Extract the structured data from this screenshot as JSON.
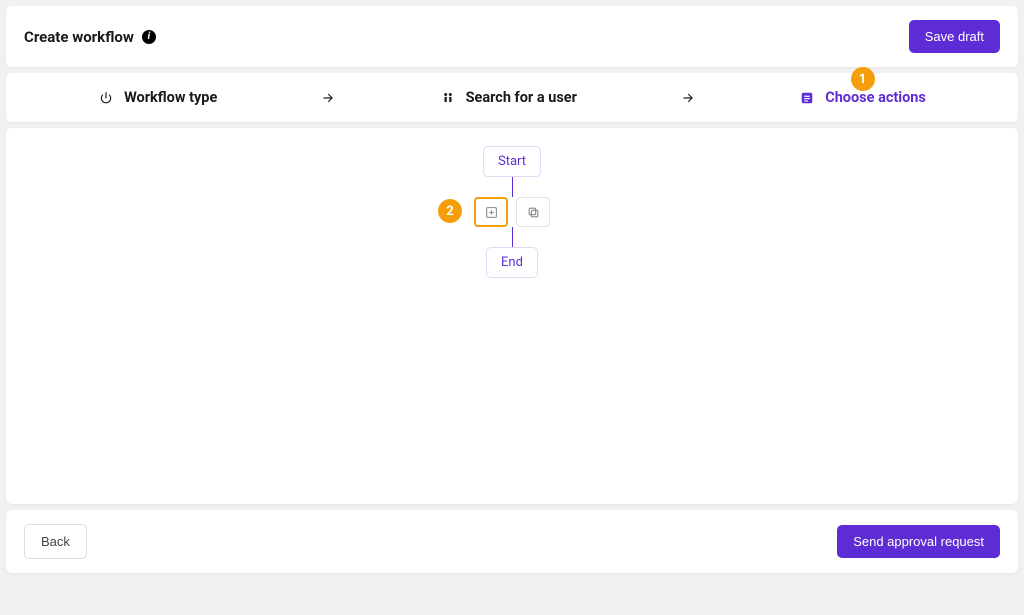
{
  "header": {
    "title": "Create workflow",
    "save_draft_label": "Save draft"
  },
  "steps": {
    "items": [
      {
        "label": "Workflow type",
        "icon": "power-icon"
      },
      {
        "label": "Search for a user",
        "icon": "users-icon"
      },
      {
        "label": "Choose actions",
        "icon": "checklist-icon"
      }
    ],
    "active_index": 2
  },
  "callouts": {
    "one": "1",
    "two": "2"
  },
  "flow": {
    "start_label": "Start",
    "end_label": "End",
    "add_icon": "plus-square-icon",
    "copy_icon": "copy-icon"
  },
  "footer": {
    "back_label": "Back",
    "submit_label": "Send approval request"
  }
}
